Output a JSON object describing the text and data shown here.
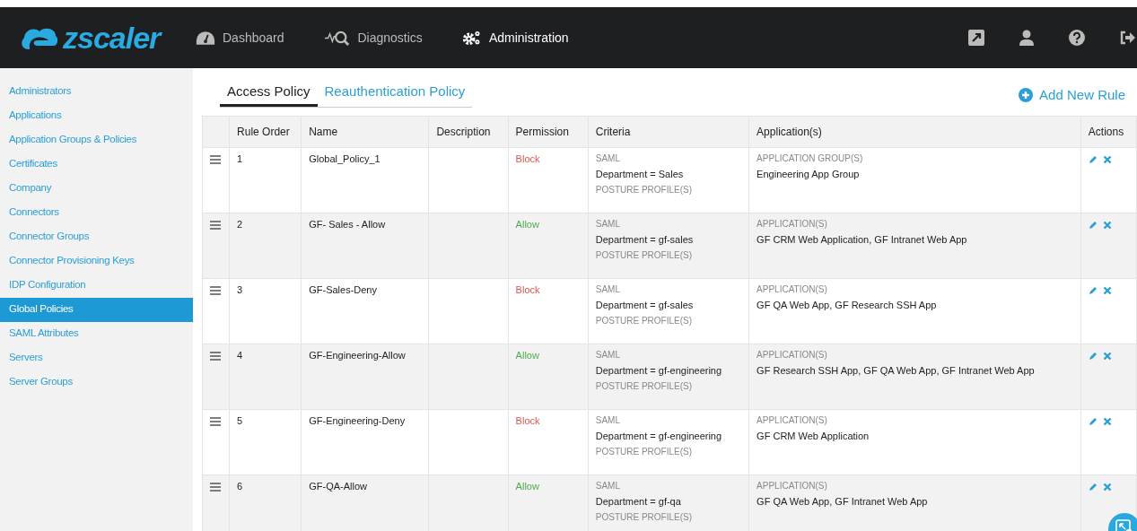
{
  "nav": {
    "logo": "zscaler",
    "items": [
      {
        "label": "Dashboard",
        "kind": "gauge",
        "selected": false
      },
      {
        "label": "Diagnostics",
        "kind": "diagnostics",
        "selected": false
      },
      {
        "label": "Administration",
        "kind": "gears",
        "selected": true
      }
    ]
  },
  "sidebar": {
    "items": [
      {
        "label": "Administrators",
        "selected": false
      },
      {
        "label": "Applications",
        "selected": false
      },
      {
        "label": "Application Groups & Policies",
        "selected": false
      },
      {
        "label": "Certificates",
        "selected": false
      },
      {
        "label": "Company",
        "selected": false
      },
      {
        "label": "Connectors",
        "selected": false
      },
      {
        "label": "Connector Groups",
        "selected": false
      },
      {
        "label": "Connector Provisioning Keys",
        "selected": false
      },
      {
        "label": "IDP Configuration",
        "selected": false
      },
      {
        "label": "Global Policies",
        "selected": true
      },
      {
        "label": "SAML Attributes",
        "selected": false
      },
      {
        "label": "Servers",
        "selected": false
      },
      {
        "label": "Server Groups",
        "selected": false
      }
    ]
  },
  "tabs": [
    {
      "label": "Access Policy",
      "selected": true
    },
    {
      "label": "Reauthentication Policy",
      "selected": false
    }
  ],
  "add_button": "Add New Rule",
  "table": {
    "columns": [
      "Rule Order",
      "Name",
      "Description",
      "Permission",
      "Criteria",
      "Application(s)",
      "Actions"
    ],
    "rows": [
      {
        "order": "1",
        "name": "Global_Policy_1",
        "permission": {
          "text": "Block",
          "kind": "block"
        },
        "criteria": {
          "label": "SAML",
          "value": "Department = Sales",
          "posture": "POSTURE PROFILE(S)"
        },
        "applications": {
          "label": "APPLICATION GROUP(S)",
          "value": "Engineering App Group"
        }
      },
      {
        "order": "2",
        "name": "GF- Sales - Allow",
        "permission": {
          "text": "Allow",
          "kind": "allow"
        },
        "criteria": {
          "label": "SAML",
          "value": "Department = gf-sales",
          "posture": "POSTURE PROFILE(S)"
        },
        "applications": {
          "label": "APPLICATION(S)",
          "value": "GF CRM Web Application, GF Intranet Web App"
        }
      },
      {
        "order": "3",
        "name": "GF-Sales-Deny",
        "permission": {
          "text": "Block",
          "kind": "block"
        },
        "criteria": {
          "label": "SAML",
          "value": "Department = gf-sales",
          "posture": "POSTURE PROFILE(S)"
        },
        "applications": {
          "label": "APPLICATION(S)",
          "value": "GF QA Web App, GF Research SSH App"
        }
      },
      {
        "order": "4",
        "name": "GF-Engineering-Allow",
        "permission": {
          "text": "Allow",
          "kind": "allow"
        },
        "criteria": {
          "label": "SAML",
          "value": "Department = gf-engineering",
          "posture": "POSTURE PROFILE(S)"
        },
        "applications": {
          "label": "APPLICATION(S)",
          "value": "GF Research SSH App, GF QA Web App, GF Intranet Web App"
        }
      },
      {
        "order": "5",
        "name": "GF-Engineering-Deny",
        "permission": {
          "text": "Block",
          "kind": "block"
        },
        "criteria": {
          "label": "SAML",
          "value": "Department = gf-engineering",
          "posture": "POSTURE PROFILE(S)"
        },
        "applications": {
          "label": "APPLICATION(S)",
          "value": "GF CRM Web Application"
        }
      },
      {
        "order": "6",
        "name": "GF-QA-Allow",
        "permission": {
          "text": "Allow",
          "kind": "allow"
        },
        "criteria": {
          "label": "SAML",
          "value": "Department = gf-qa",
          "posture": "POSTURE PROFILE(S)"
        },
        "applications": {
          "label": "APPLICATION(S)",
          "value": "GF QA Web App, GF Intranet Web App"
        }
      }
    ]
  }
}
